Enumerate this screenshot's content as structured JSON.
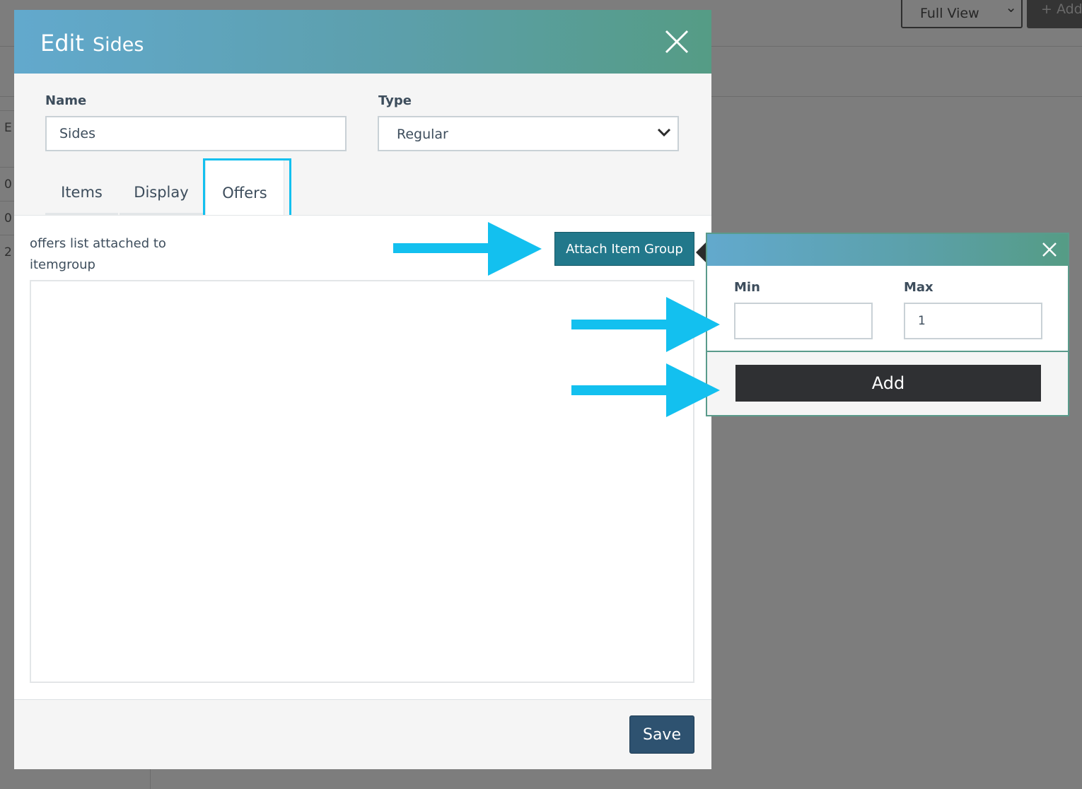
{
  "background": {
    "view_select": {
      "value": "Full View"
    },
    "add_button": {
      "label": "+ Add"
    },
    "table_cells": [
      "E p",
      "0",
      "0",
      "2"
    ]
  },
  "modal": {
    "title": "Edit",
    "subtitle": "Sides",
    "name_label": "Name",
    "name_value": "Sides",
    "type_label": "Type",
    "type_value": "Regular",
    "tabs": [
      {
        "label": "Items",
        "active": false
      },
      {
        "label": "Display",
        "active": false
      },
      {
        "label": "Offers",
        "active": true
      }
    ],
    "offers_description": "offers list attached to itemgroup",
    "attach_button": "Attach Item Group",
    "save_button": "Save"
  },
  "popover": {
    "min_label": "Min",
    "min_value": "",
    "max_label": "Max",
    "max_value": "1",
    "add_button": "Add"
  },
  "colors": {
    "header_gradient_start": "#62a9cd",
    "header_gradient_end": "#559c85",
    "attach_button": "#22788b",
    "save_button": "#2e5270",
    "add_button": "#2f3033",
    "annotation_arrow": "#13c0ef"
  }
}
